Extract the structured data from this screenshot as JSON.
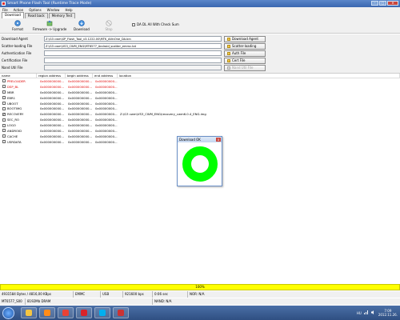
{
  "window": {
    "title": "Smart Phone Flash Tool (Runtime Trace Mode)",
    "buttons": [
      "–",
      "□",
      "✕"
    ]
  },
  "menu": [
    "File",
    "Action",
    "Options",
    "Window",
    "Help"
  ],
  "tabs": [
    "Download",
    "Read back",
    "Memory Test"
  ],
  "toolbar": {
    "format": "Format",
    "firmware_upgrade": "Firmware -> Upgrade",
    "download": "Download",
    "stop": "Stop",
    "da_checksum": "DA DL All With Check Sum"
  },
  "files": {
    "download_agent": {
      "label": "Download Agent",
      "path": "Z:\\G3 cwm\\SP_Flash_Tool_v3.1222.00\\MTK_AllInOne_DA.bin",
      "button": "Download Agent"
    },
    "scatter": {
      "label": "Scatter-loading File",
      "path": "Z:\\G3 cwm\\VS3_CWM_ENG\\MT6577_Android_scatter_emmc.txt",
      "button": "Scatter-loading"
    },
    "auth": {
      "label": "Authentication File",
      "path": "",
      "button": "Auth File"
    },
    "cert": {
      "label": "Certification File",
      "path": "",
      "button": "Cert File"
    },
    "nand": {
      "label": "Nand Util File",
      "path": "",
      "button": "Nand Util File"
    }
  },
  "table": {
    "headers": [
      "name",
      "region address",
      "begin address",
      "end address",
      "location"
    ],
    "rows": [
      {
        "name": "PRELOADER",
        "checked": false,
        "red": true,
        "region": "0x000000000...",
        "begin": "0x000000000...",
        "end": "0x00000000...",
        "location": ""
      },
      {
        "name": "DSP_BL",
        "checked": false,
        "red": true,
        "region": "0x000000000...",
        "begin": "0x000000000...",
        "end": "0x00000000...",
        "location": ""
      },
      {
        "name": "MBR",
        "checked": false,
        "red": false,
        "region": "0x000000000...",
        "begin": "0x000000000...",
        "end": "0x00000000...",
        "location": ""
      },
      {
        "name": "EBR1",
        "checked": false,
        "red": false,
        "region": "0x000000000...",
        "begin": "0x000000000...",
        "end": "0x00000000...",
        "location": ""
      },
      {
        "name": "UBOOT",
        "checked": false,
        "red": false,
        "region": "0x000000000...",
        "begin": "0x000000000...",
        "end": "0x00000000...",
        "location": ""
      },
      {
        "name": "BOOTIMG",
        "checked": false,
        "red": false,
        "region": "0x000000000...",
        "begin": "0x000000000...",
        "end": "0x00000000...",
        "location": ""
      },
      {
        "name": "RECOVERY",
        "checked": true,
        "red": false,
        "region": "0x000000000...",
        "begin": "0x000000000...",
        "end": "0x00000000...",
        "location": "Z:\\G3 cwm\\VS3_CWM_ENG\\recovery_cwm6.0.4_ENG.img"
      },
      {
        "name": "SEC_RO",
        "checked": false,
        "red": false,
        "region": "0x000000000...",
        "begin": "0x000000000...",
        "end": "0x00000000...",
        "location": ""
      },
      {
        "name": "LOGO",
        "checked": false,
        "red": false,
        "region": "0x000000000...",
        "begin": "0x000000000...",
        "end": "0x00000000...",
        "location": ""
      },
      {
        "name": "ANDROID",
        "checked": false,
        "red": false,
        "region": "0x000000000...",
        "begin": "0x000000000...",
        "end": "0x00000000...",
        "location": ""
      },
      {
        "name": "CACHE",
        "checked": false,
        "red": false,
        "region": "0x000000000...",
        "begin": "0x000000000...",
        "end": "0x00000000...",
        "location": ""
      },
      {
        "name": "USRDATA",
        "checked": false,
        "red": false,
        "region": "0x000000000...",
        "begin": "0x000000000...",
        "end": "0x00000000...",
        "location": ""
      }
    ]
  },
  "dialog": {
    "title": "Download OK",
    "close": "x",
    "ring_color": "#00ff00"
  },
  "progress": {
    "label": "100%",
    "percent": 100,
    "color": "#ffff00"
  },
  "status1": [
    "4931584 Bytes / 4816,00 KBps",
    "EMMC",
    "USB",
    "921600 bps",
    "0:06 sec",
    "NOR: N/A"
  ],
  "status2": [
    "MT6577_S00",
    "8192Mb DRAM",
    "NAND: N/A"
  ],
  "taskbar": {
    "apps": [
      {
        "icon": "explorer-icon",
        "color": "#f4c542"
      },
      {
        "icon": "media-player-icon",
        "color": "#ff8c1a"
      },
      {
        "icon": "chrome-icon",
        "color": "#e94235"
      },
      {
        "icon": "opera-icon",
        "color": "#d8232a"
      },
      {
        "icon": "skype-icon",
        "color": "#00aff0"
      },
      {
        "icon": "flash-tool-icon",
        "color": "#c33"
      }
    ],
    "lang": "HU",
    "time": "7:09",
    "date": "2012.11.26."
  }
}
